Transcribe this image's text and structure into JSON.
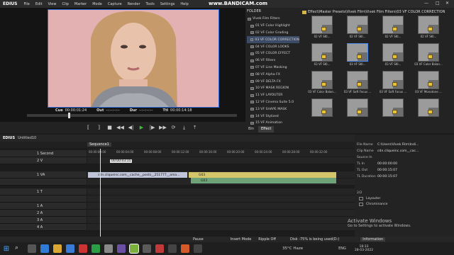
{
  "app": {
    "logo": "EDIUS",
    "watermark": "www.BANDICAM.com"
  },
  "menu": [
    "File",
    "Edit",
    "View",
    "Clip",
    "Marker",
    "Mode",
    "Capture",
    "Render",
    "Tools",
    "Settings",
    "Help"
  ],
  "player": {
    "cue_in_label": "Cue",
    "cue_in": "00:00:01:24",
    "out_label": "Out",
    "out_val": "--:--:--:--",
    "dur_label": "Dur",
    "dur_val": "--:--:--:--",
    "ttl_label": "Ttl",
    "ttl_val": "00:00:14:18"
  },
  "bin": {
    "folder_header": "FOLDER",
    "folders": [
      "Vivek Film Filters",
      "01 VF Color Highlight",
      "02 VF Color Grading",
      "03 VF COLOR CORRECTION",
      "04 VF COLOR LOOKS",
      "05 VF COLOR EFFECT",
      "06 VF Filters",
      "07 VF Line Masking",
      "08 VF Alpha FX",
      "09 VF DELTA FX",
      "10 VF MASK REGION",
      "11 VF LAYOUTER",
      "12 VF Cinema Suite 5.0",
      "13 VF SHAPE MASK",
      "14 VF Stylized",
      "15 VF Animation"
    ],
    "path": "Effect\\Master Presets\\Vivek Film\\Vivek Film Filters\\03 VF COLOR CORRECTION",
    "thumbs": [
      "02 VF SKI...",
      "02 VF SKI...",
      "02 VF SKI...",
      "02 VF SKI...",
      "03 VF SKI...",
      "03 VF SKI...",
      "03 VF SKI...",
      "03 VF Color Balan...",
      "03 VF Color Balan...",
      "03 VF Soft Focus ...",
      "03 VF Soft Focus ...",
      "03 VF Monotone ...",
      "",
      "",
      "",
      ""
    ],
    "tabs": [
      "Bin",
      "Effect"
    ]
  },
  "timeline": {
    "title": "EDIUS",
    "project": "Untitled10",
    "sequence": "Sequence1",
    "tooltip": "00:00:03:15",
    "ruler": [
      "00:00:00:00",
      "00:00:04:00",
      "00:00:08:00",
      "00:00:12:00",
      "00:00:16:00",
      "00:00:20:00",
      "00:00:24:00",
      "00:00:28:00",
      "00:00:32:00"
    ],
    "tracks": [
      {
        "name": "1 Second"
      },
      {
        "name": "2 V"
      },
      {
        "name": "1 VA"
      },
      {
        "name": ""
      },
      {
        "name": "1 T"
      },
      {
        "name": ""
      },
      {
        "name": "1 A"
      },
      {
        "name": "2 A"
      },
      {
        "name": "3 A"
      },
      {
        "name": "4 A"
      }
    ],
    "clips": {
      "va_main": "cdn.cliqueinc.com__cache__posts__251777__ama...",
      "va_g03": "G03",
      "va_fx": "G03"
    }
  },
  "info": {
    "rows": [
      {
        "k": "File Name",
        "v": "C:\\Users\\Vivek Film\\Indi..."
      },
      {
        "k": "Clip Name",
        "v": "cdn.cliqueinc.com__cac..."
      },
      {
        "k": "Source In",
        "v": ""
      },
      {
        "k": "TL In",
        "v": "00:00:00:00"
      },
      {
        "k": "TL Out",
        "v": "00:00:15:07"
      },
      {
        "k": "TL Duration",
        "v": "00:00:15:07"
      },
      {
        "k": "",
        "v": ""
      }
    ],
    "fx_count": "2/2",
    "effects": [
      "Layouter",
      "Chrominance"
    ],
    "tab": "Information"
  },
  "activate": {
    "line1": "Activate Windows",
    "line2": "Go to Settings to activate Windows."
  },
  "status": {
    "pause": "Pause",
    "mode": "Insert Mode",
    "ripple": "Ripple Off",
    "disk": "Disk :75% is being used(D:)"
  },
  "taskbar": {
    "weather": "35°C Haze",
    "lang": "ENG",
    "time": "18:33",
    "date": "28-03-2022"
  }
}
